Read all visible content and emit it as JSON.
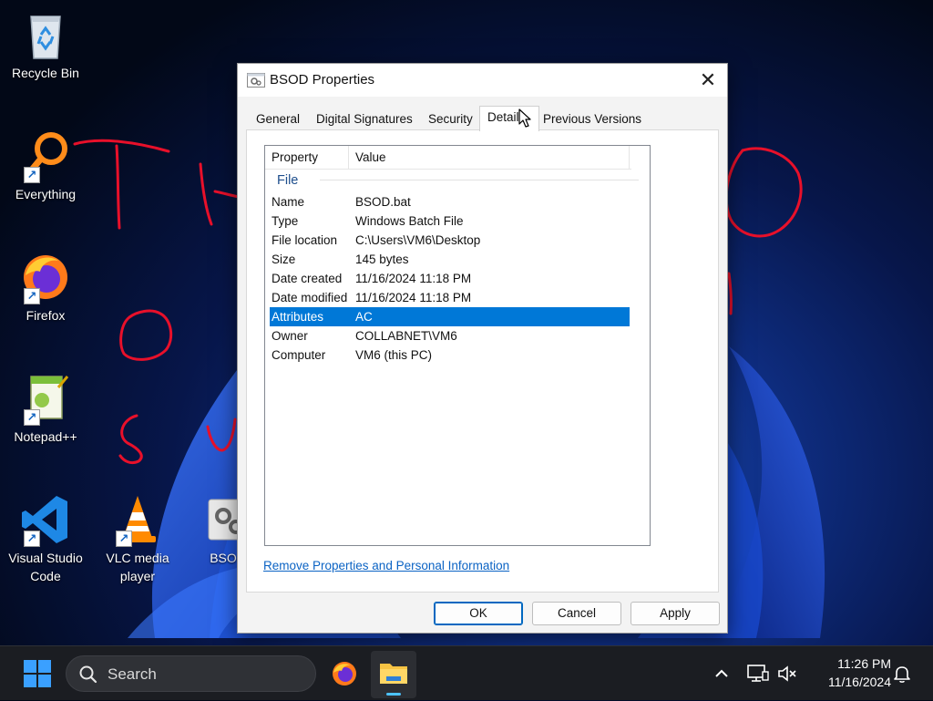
{
  "desktop": {
    "icons": [
      {
        "label": "Recycle Bin"
      },
      {
        "label": "Everything"
      },
      {
        "label": "Firefox"
      },
      {
        "label": "Notepad++"
      },
      {
        "label": "Visual Studio Code"
      },
      {
        "label": "VLC media player"
      },
      {
        "label": "BSO"
      }
    ],
    "shortcut_arrow": "↗"
  },
  "dialog": {
    "title": "BSOD Properties",
    "close_glyph": "✕",
    "tabs": [
      "General",
      "Digital Signatures",
      "Security",
      "Details",
      "Previous Versions"
    ],
    "active_tab": "Details",
    "columns": {
      "property": "Property",
      "value": "Value"
    },
    "group": "File",
    "rows": [
      {
        "property": "Name",
        "value": "BSOD.bat"
      },
      {
        "property": "Type",
        "value": "Windows Batch File"
      },
      {
        "property": "File location",
        "value": "C:\\Users\\VM6\\Desktop"
      },
      {
        "property": "Size",
        "value": "145 bytes"
      },
      {
        "property": "Date created",
        "value": "11/16/2024 11:18 PM"
      },
      {
        "property": "Date modified",
        "value": "11/16/2024 11:18 PM"
      },
      {
        "property": "Attributes",
        "value": "AC",
        "selected": true
      },
      {
        "property": "Owner",
        "value": "COLLABNET\\VM6"
      },
      {
        "property": "Computer",
        "value": "VM6 (this PC)"
      }
    ],
    "remove_link": "Remove Properties and Personal Information",
    "buttons": {
      "ok": "OK",
      "cancel": "Cancel",
      "apply": "Apply"
    }
  },
  "taskbar": {
    "search_label": "Search",
    "clock_time": "11:26 PM",
    "clock_date": "11/16/2024"
  },
  "colors": {
    "selection": "#0078d7",
    "accent": "#0067c0",
    "link": "#0b63c4",
    "annotation_ink": "#e8102a"
  }
}
